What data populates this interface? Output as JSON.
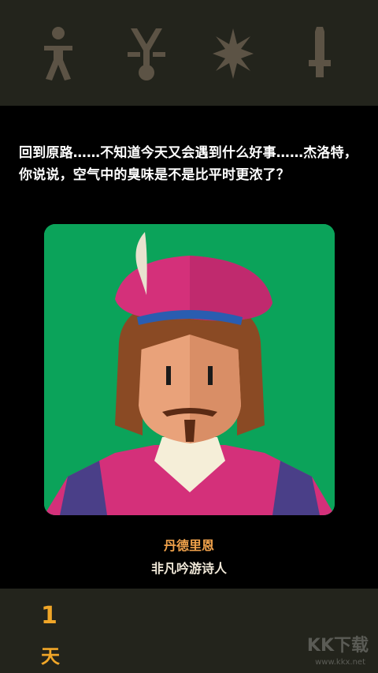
{
  "stats": {
    "icons": [
      "person-icon",
      "staff-icon",
      "star-icon",
      "sword-icon"
    ],
    "color": "#5c5345"
  },
  "dialogue": {
    "text": "回到原路……不知道今天又会遇到什么好事……杰洛特，你说说，空气中的臭味是不是比平时更浓了？"
  },
  "character": {
    "name": "丹德里恩",
    "title": "非凡吟游诗人",
    "portrait_bg": "#0ba35a"
  },
  "day": {
    "number": "1",
    "unit": "天"
  },
  "watermark": {
    "text": "KK下载",
    "url": "www.kkx.net"
  },
  "colors": {
    "bar_bg": "#23241c",
    "accent": "#f0a628",
    "name_color": "#f0a24b"
  }
}
